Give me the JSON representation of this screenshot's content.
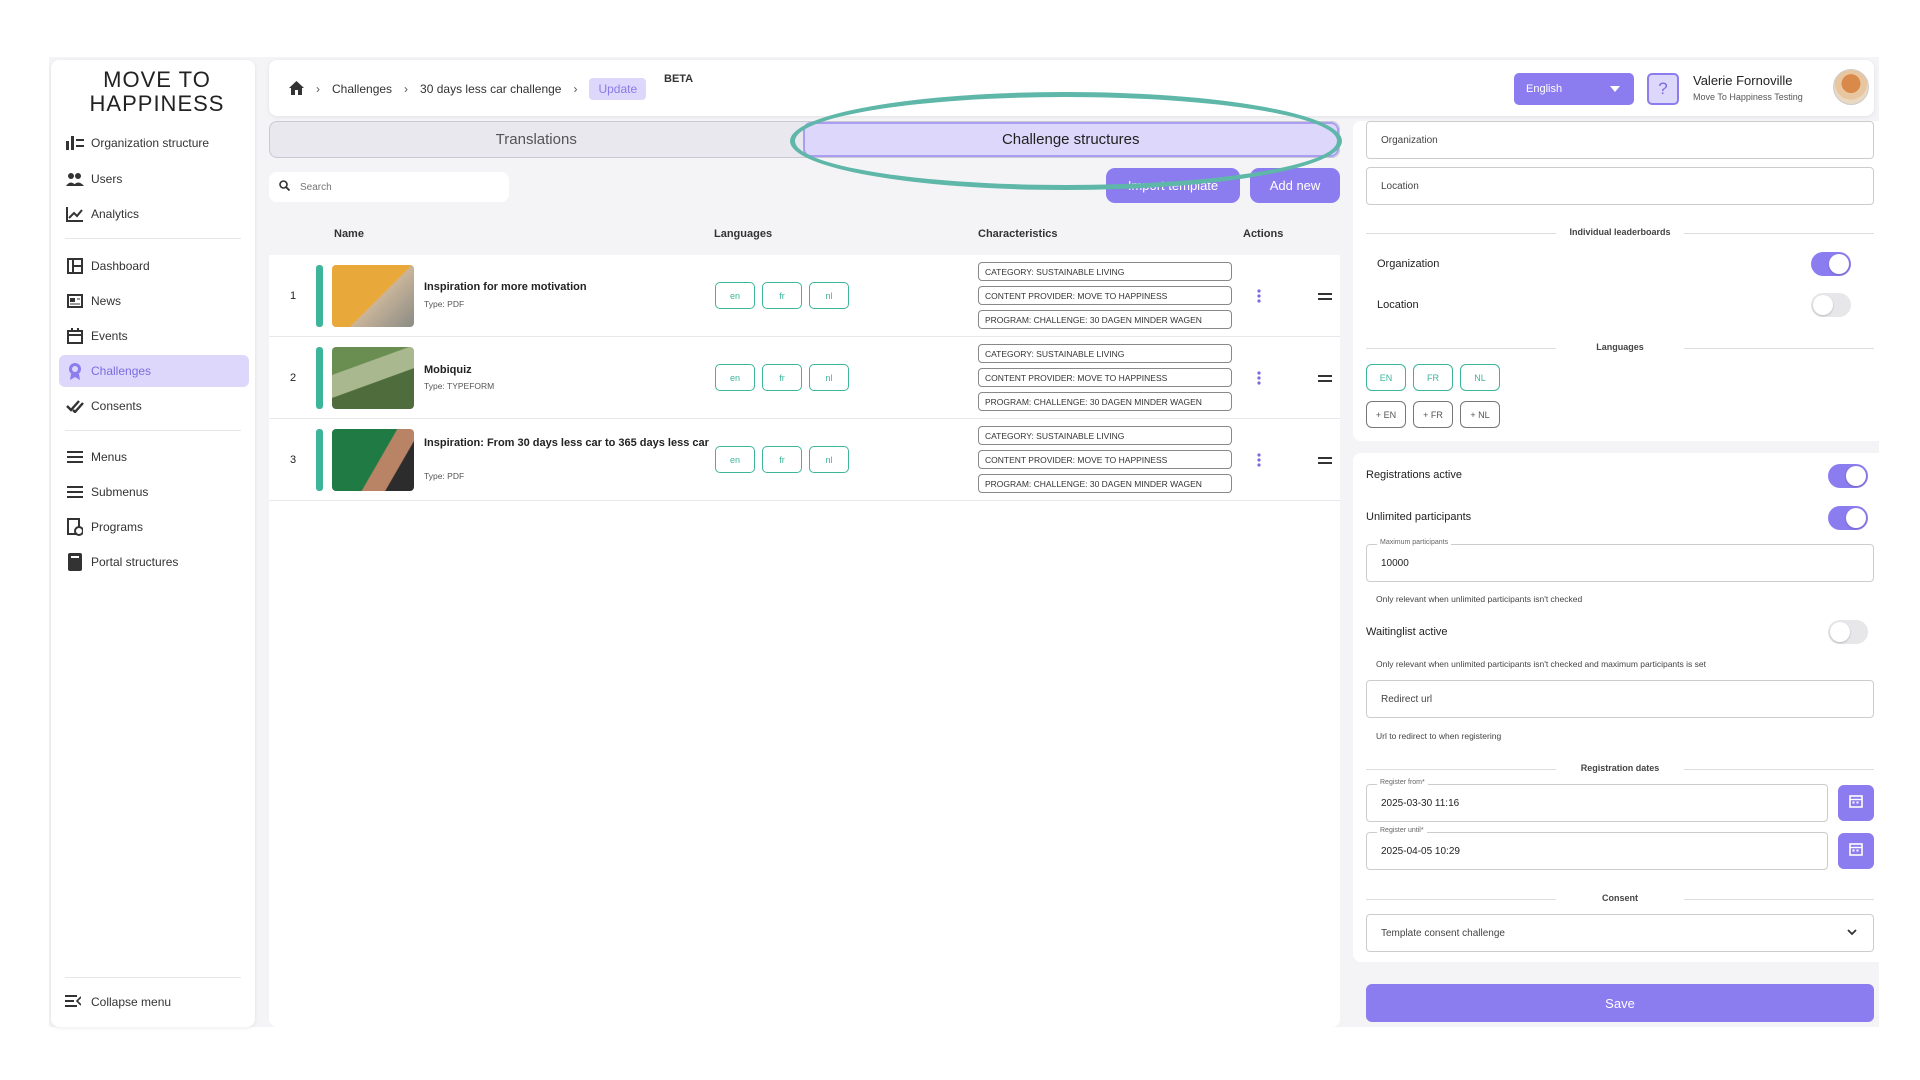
{
  "brand": {
    "line1": "MOVE TO",
    "line2": "HAPPINESS"
  },
  "sidebar": {
    "items": [
      {
        "label": "Organization structure",
        "icon": "org-structure-icon"
      },
      {
        "label": "Users",
        "icon": "users-icon"
      },
      {
        "label": "Analytics",
        "icon": "analytics-icon"
      },
      {
        "label": "Dashboard",
        "icon": "dashboard-icon"
      },
      {
        "label": "News",
        "icon": "news-icon"
      },
      {
        "label": "Events",
        "icon": "calendar-icon"
      },
      {
        "label": "Challenges",
        "icon": "award-icon"
      },
      {
        "label": "Consents",
        "icon": "double-check-icon"
      },
      {
        "label": "Menus",
        "icon": "menu-icon"
      },
      {
        "label": "Submenus",
        "icon": "submenu-icon"
      },
      {
        "label": "Programs",
        "icon": "programs-icon"
      },
      {
        "label": "Portal structures",
        "icon": "book-icon"
      }
    ],
    "active": "Challenges",
    "collapse_label": "Collapse menu"
  },
  "header": {
    "breadcrumb": [
      "Challenges",
      "30 days less car challenge",
      "Update"
    ],
    "beta": "BETA",
    "language": "English",
    "help": "?",
    "user_name": "Valerie Fornoville",
    "user_org": "Move To Happiness Testing"
  },
  "tabs": {
    "translations": "Translations",
    "structures": "Challenge structures"
  },
  "toolbar": {
    "search_placeholder": "Search",
    "import_label": "Import template",
    "add_label": "Add new"
  },
  "table": {
    "columns": {
      "name": "Name",
      "languages": "Languages",
      "characteristics": "Characteristics",
      "actions": "Actions"
    },
    "rows": [
      {
        "num": "1",
        "title": "Inspiration for more motivation",
        "type": "Type: PDF",
        "langs": [
          "en",
          "fr",
          "nl"
        ],
        "chars": [
          "CATEGORY: SUSTAINABLE LIVING",
          "CONTENT PROVIDER: MOVE TO HAPPINESS",
          "PROGRAM: CHALLENGE: 30 DAGEN MINDER WAGEN"
        ]
      },
      {
        "num": "2",
        "title": "Mobiquiz",
        "type": "Type: TYPEFORM",
        "langs": [
          "en",
          "fr",
          "nl"
        ],
        "chars": [
          "CATEGORY: SUSTAINABLE LIVING",
          "CONTENT PROVIDER: MOVE TO HAPPINESS",
          "PROGRAM: CHALLENGE: 30 DAGEN MINDER WAGEN"
        ]
      },
      {
        "num": "3",
        "title": "Inspiration: From 30 days less car to 365 days less car",
        "type": "Type: PDF",
        "langs": [
          "en",
          "fr",
          "nl"
        ],
        "chars": [
          "CATEGORY: SUSTAINABLE LIVING",
          "CONTENT PROVIDER: MOVE TO HAPPINESS",
          "PROGRAM: CHALLENGE: 30 DAGEN MINDER WAGEN"
        ]
      }
    ]
  },
  "settings": {
    "organization_placeholder": "Organization",
    "location_placeholder": "Location",
    "leaderboards_title": "Individual leaderboards",
    "lb_organization": "Organization",
    "lb_location": "Location",
    "languages_title": "Languages",
    "langs": [
      "EN",
      "FR",
      "NL"
    ],
    "add_langs": [
      "+ EN",
      "+ FR",
      "+ NL"
    ],
    "registrations_active": "Registrations active",
    "unlimited_participants": "Unlimited participants",
    "max_participants_label": "Maximum participants",
    "max_participants_value": "10000",
    "max_participants_hint": "Only relevant when unlimited participants isn't checked",
    "waitinglist_active": "Waitinglist active",
    "waitinglist_hint": "Only relevant when unlimited participants isn't checked and maximum participants is set",
    "redirect_placeholder": "Redirect url",
    "redirect_hint": "Url to redirect to when registering",
    "dates_title": "Registration dates",
    "register_from_label": "Register from*",
    "register_from_value": "2025-03-30 11:16",
    "register_until_label": "Register until*",
    "register_until_value": "2025-04-05 10:29",
    "consent_title": "Consent",
    "consent_value": "Template consent challenge",
    "save_label": "Save"
  },
  "colors": {
    "accent": "#8b7cf0",
    "accent_light": "#ddd7fb",
    "green": "#3db59a",
    "highlight_ring": "#5eb7a8"
  }
}
